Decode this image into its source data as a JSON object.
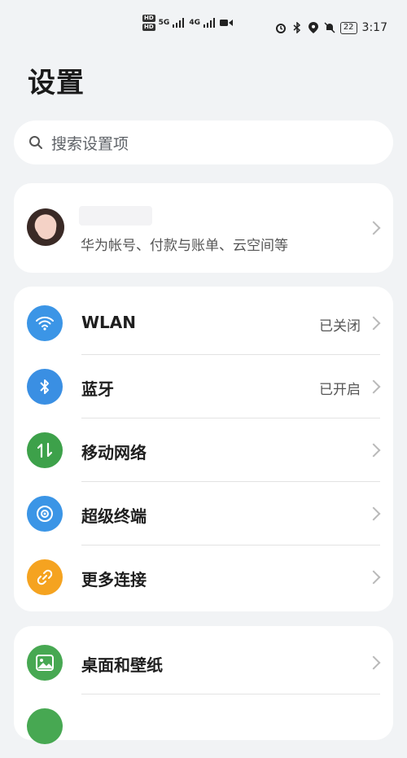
{
  "status_bar": {
    "hd1": "HD",
    "hd2": "HD",
    "net1": "5G",
    "net2": "4G",
    "battery": "22",
    "time": "3:17"
  },
  "page": {
    "title": "设置"
  },
  "search": {
    "placeholder": "搜索设置项"
  },
  "account": {
    "subtitle": "华为帐号、付款与账单、云空间等"
  },
  "connectivity": [
    {
      "label": "WLAN",
      "value": "已关闭",
      "color": "#3b95e6",
      "icon": "wifi-icon"
    },
    {
      "label": "蓝牙",
      "value": "已开启",
      "color": "#3a8fe3",
      "icon": "bluetooth-icon"
    },
    {
      "label": "移动网络",
      "value": "",
      "color": "#3da14a",
      "icon": "mobile-network-icon"
    },
    {
      "label": "超级终端",
      "value": "",
      "color": "#3b95e6",
      "icon": "super-device-icon"
    },
    {
      "label": "更多连接",
      "value": "",
      "color": "#f5a320",
      "icon": "link-icon"
    }
  ],
  "display": [
    {
      "label": "桌面和壁纸",
      "value": "",
      "color": "#47a852",
      "icon": "wallpaper-icon"
    }
  ]
}
